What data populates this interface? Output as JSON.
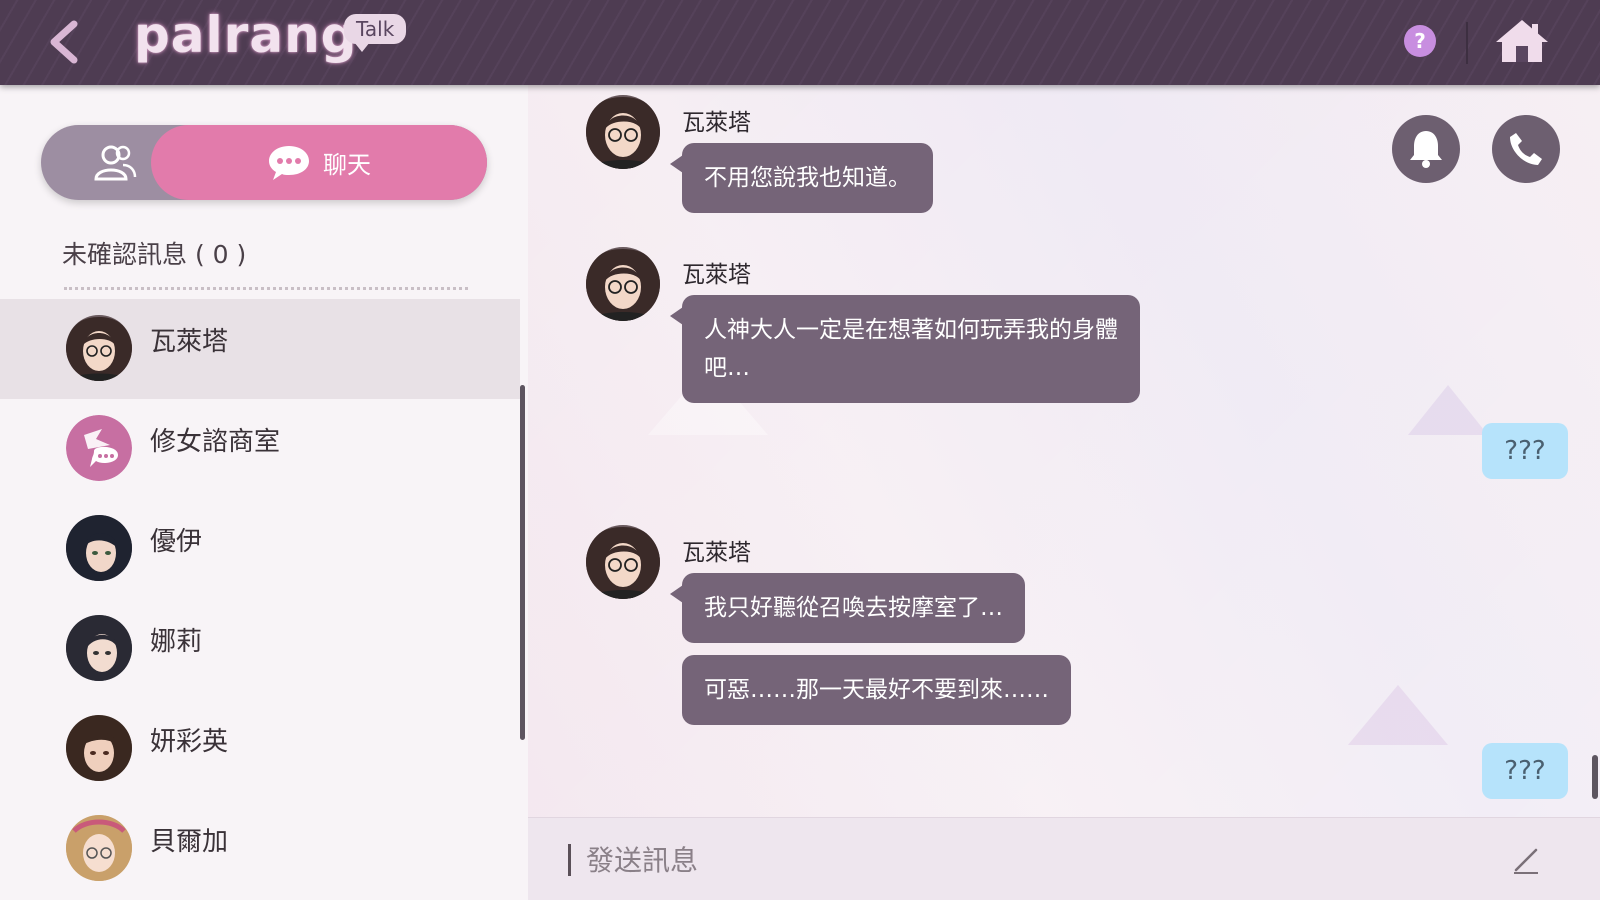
{
  "header": {
    "logo_text": "palrang",
    "logo_badge": "Talk",
    "help_label": "?"
  },
  "sidebar": {
    "chat_tab_label": "聊天",
    "unread_title": "未確認訊息 ( 0 )",
    "contacts": [
      {
        "name": "瓦萊塔"
      },
      {
        "name": "修女諮商室"
      },
      {
        "name": "優伊"
      },
      {
        "name": "娜莉"
      },
      {
        "name": "妍彩英"
      },
      {
        "name": "貝爾加"
      }
    ]
  },
  "chat": {
    "messages": [
      {
        "sender": "瓦萊塔",
        "texts": [
          "不用您說我也知道。"
        ]
      },
      {
        "sender": "瓦萊塔",
        "texts": [
          "人神大人一定是在想著如何玩弄我的身體",
          "吧…"
        ]
      },
      {
        "reply": "???"
      },
      {
        "sender": "瓦萊塔",
        "texts": [
          "我只好聽從召喚去按摩室了…",
          "可惡……那一天最好不要到來……"
        ]
      },
      {
        "reply": "???"
      }
    ]
  },
  "input": {
    "placeholder": "發送訊息"
  },
  "colors": {
    "accent_pink": "#e27bab",
    "bubble_purple": "#756478",
    "reply_blue": "#b6e3fb"
  }
}
